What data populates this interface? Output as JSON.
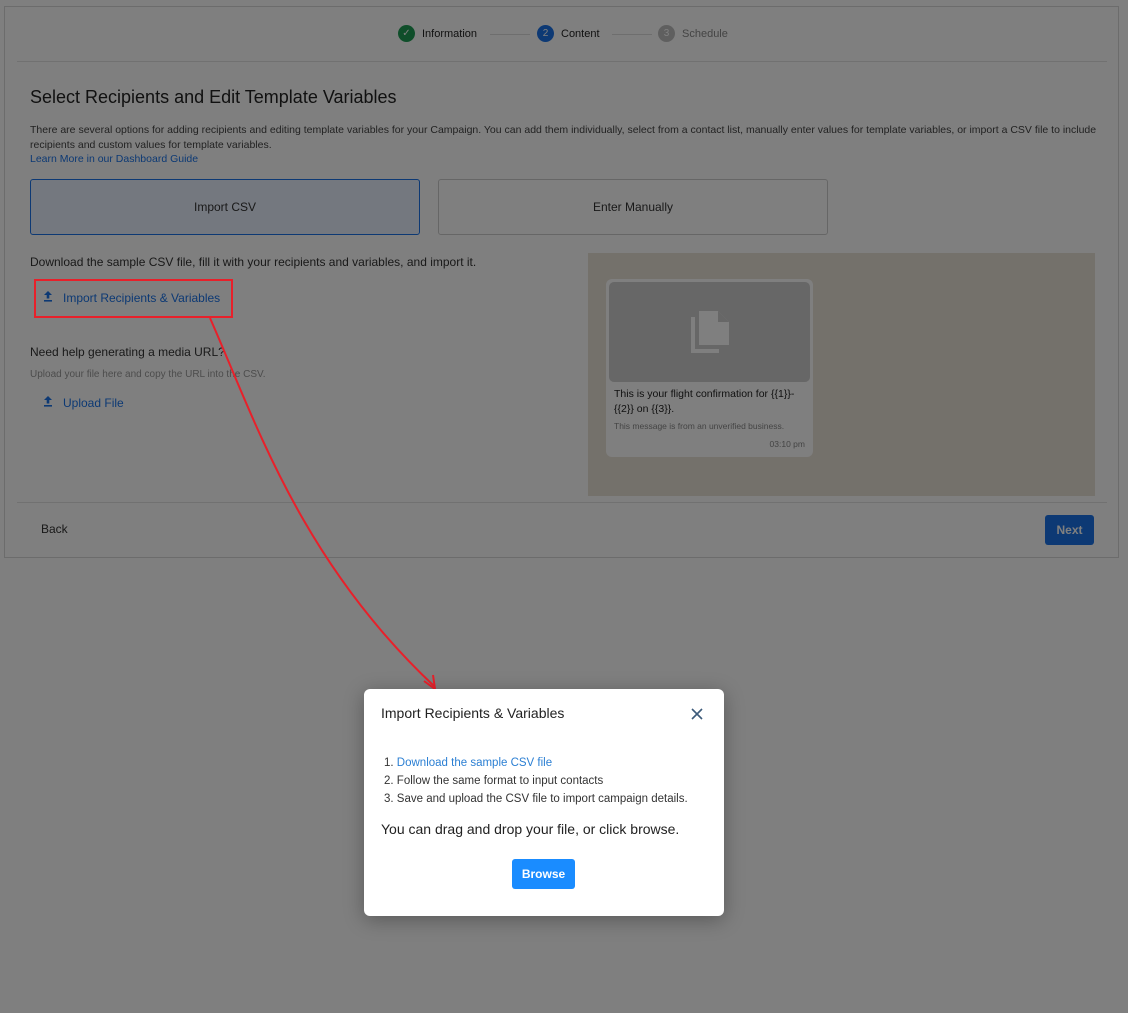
{
  "stepper": {
    "steps": [
      {
        "label": "Information",
        "state": "done",
        "marker": "✓"
      },
      {
        "label": "Content",
        "state": "active",
        "marker": "2"
      },
      {
        "label": "Schedule",
        "state": "pending",
        "marker": "3"
      }
    ]
  },
  "page": {
    "title": "Select Recipients and Edit Template Variables",
    "description": "There are several options for adding recipients and editing template variables for your Campaign. You can add them individually, select from a contact list, manually enter values for template variables, or import a CSV file to include recipients and custom values for template variables.",
    "learn_more": "Learn More in our Dashboard Guide"
  },
  "options": {
    "import_csv": "Import CSV",
    "enter_manually": "Enter Manually"
  },
  "import_section": {
    "instruction": "Download the sample CSV file, fill it with your recipients and variables, and import it.",
    "import_link": "Import Recipients & Variables",
    "help_title": "Need help generating a media URL?",
    "help_sub": "Upload your file here and copy the URL into the CSV.",
    "upload_link": "Upload File"
  },
  "preview": {
    "message": "This is your flight confirmation for {{1}}-{{2}} on {{3}}.",
    "unverified": "This message is from an unverified business.",
    "time": "03:10 pm"
  },
  "footer": {
    "back": "Back",
    "next": "Next"
  },
  "modal": {
    "title": "Import Recipients & Variables",
    "close_icon": "close-icon",
    "steps": [
      {
        "num": "1.",
        "text": "Download the sample CSV file",
        "link": true
      },
      {
        "num": "2.",
        "text": "Follow the same format to input contacts",
        "link": false
      },
      {
        "num": "3.",
        "text": "Save and upload the CSV file to import campaign details.",
        "link": false
      }
    ],
    "drag_text": "You can drag and drop your file, or click browse.",
    "browse": "Browse"
  },
  "colors": {
    "accent": "#1a73e8",
    "success": "#1f9d55",
    "annotation": "#e8202a"
  }
}
